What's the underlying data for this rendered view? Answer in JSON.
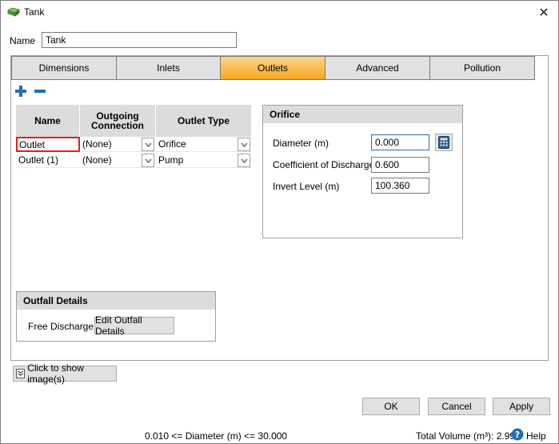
{
  "window": {
    "title": "Tank",
    "close_glyph": "✕"
  },
  "name_field": {
    "label": "Name",
    "value": "Tank"
  },
  "tabs": [
    {
      "label": "Dimensions",
      "active": false
    },
    {
      "label": "Inlets",
      "active": false
    },
    {
      "label": "Outlets",
      "active": true
    },
    {
      "label": "Advanced",
      "active": false
    },
    {
      "label": "Pollution",
      "active": false
    }
  ],
  "grid": {
    "headers": [
      "Name",
      "Outgoing Connection",
      "Outlet Type"
    ],
    "rows": [
      {
        "name": "Outlet",
        "connection": "(None)",
        "type": "Orifice"
      },
      {
        "name": "Outlet (1)",
        "connection": "(None)",
        "type": "Pump"
      }
    ]
  },
  "orifice": {
    "title": "Orifice",
    "diameter_label": "Diameter (m)",
    "diameter_value": "0.000",
    "coef_label": "Coefficient of Discharge",
    "coef_value": "0.600",
    "invert_label": "Invert Level (m)",
    "invert_value": "100.360"
  },
  "outfall": {
    "title": "Outfall Details",
    "type_label": "Free Discharge",
    "edit_button": "Edit Outfall Details"
  },
  "show_images_button": "Click to show image(s)",
  "buttons": {
    "ok": "OK",
    "cancel": "Cancel",
    "apply": "Apply"
  },
  "status": {
    "range_hint": "0.010 <= Diameter (m) <= 30.000",
    "total_volume": "Total Volume (m³): 2.990",
    "help": "Help"
  },
  "colors": {
    "active_tab_top": "#fcd78a",
    "active_tab_bottom": "#f5a623",
    "accent_blue": "#1f6fb2",
    "selected_cell_border": "#e02020"
  }
}
